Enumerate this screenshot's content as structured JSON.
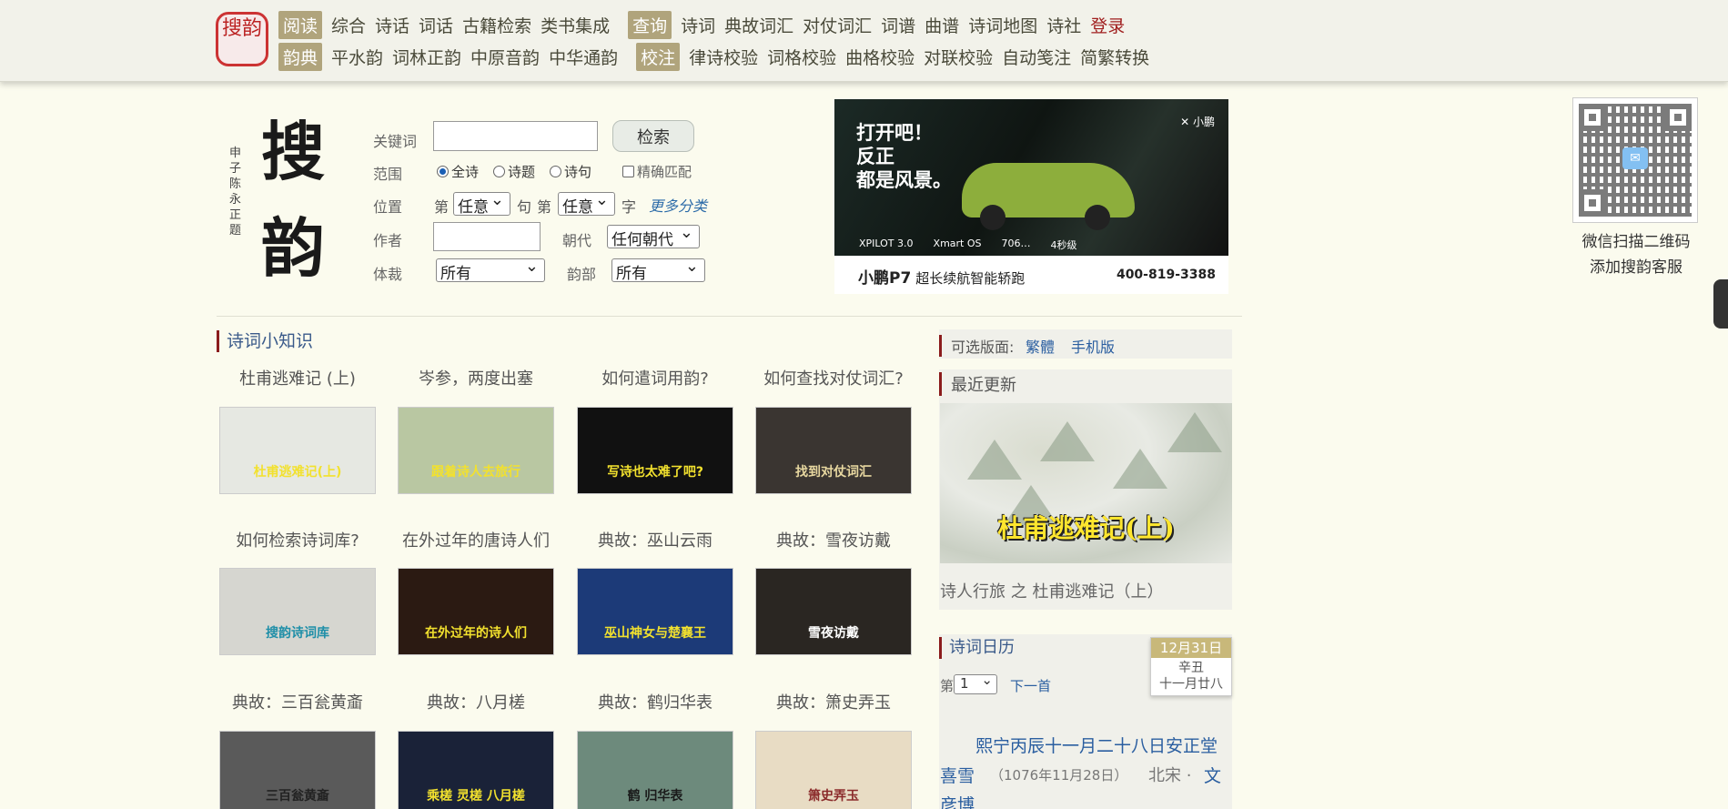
{
  "brand": {
    "logo_text": "搜韵"
  },
  "nav": {
    "row1": [
      {
        "label": "阅读",
        "tag": true
      },
      {
        "label": "综合"
      },
      {
        "label": "诗话"
      },
      {
        "label": "词话"
      },
      {
        "label": "古籍检索"
      },
      {
        "label": "类书集成"
      },
      {
        "label": "查询",
        "tag": true
      },
      {
        "label": "诗词"
      },
      {
        "label": "典故词汇"
      },
      {
        "label": "对仗词汇"
      },
      {
        "label": "词谱"
      },
      {
        "label": "曲谱"
      },
      {
        "label": "诗词地图"
      },
      {
        "label": "诗社"
      },
      {
        "label": "登录",
        "login": true
      }
    ],
    "row2": [
      {
        "label": "韵典",
        "tag": true
      },
      {
        "label": "平水韵"
      },
      {
        "label": "词林正韵"
      },
      {
        "label": "中原音韵"
      },
      {
        "label": "中华通韵"
      },
      {
        "label": "校注",
        "tag": true
      },
      {
        "label": "律诗校验"
      },
      {
        "label": "词格校验"
      },
      {
        "label": "曲格校验"
      },
      {
        "label": "对联校验"
      },
      {
        "label": "自动笺注"
      },
      {
        "label": "简繁转换"
      }
    ]
  },
  "search": {
    "calligraphy_big": "搜韵",
    "calligraphy_small": "申子陈永正题",
    "keyword_label": "关键词",
    "search_button": "检索",
    "scope_label": "范围",
    "scope_options": [
      "全诗",
      "诗题",
      "诗句"
    ],
    "scope_selected": "全诗",
    "exact_match": "精确匹配",
    "position_label": "位置",
    "pos_di1": "第",
    "pos_sentence_sel": "任意",
    "pos_ju": "句",
    "pos_di2": "第",
    "pos_char_sel": "任意",
    "pos_zi": "字",
    "more_categories": "更多分类",
    "author_label": "作者",
    "dynasty_label": "朝代",
    "dynasty_sel": "任何朝代",
    "genre_label": "体裁",
    "genre_sel": "所有",
    "rhyme_label": "韵部",
    "rhyme_sel": "所有"
  },
  "ad": {
    "headline": [
      "打开吧！",
      "反正",
      "都是风景。"
    ],
    "brand": "✕ 小鹏",
    "specs": [
      "XPILOT 3.0",
      "Xmart OS",
      "706…",
      "4秒级"
    ],
    "model": "小鹏P7",
    "tagline": "超长续航智能轿跑",
    "phone": "400-819-3388"
  },
  "qr": {
    "caption_line1": "微信扫描二维码",
    "caption_line2": "添加搜韵客服"
  },
  "knowledge": {
    "title": "诗词小知识",
    "items": [
      {
        "caption": "杜甫逃难记 (上)",
        "img_label": "杜甫逃难记(上)",
        "bg": "#e6e8e2",
        "fg": "#f2e12e"
      },
      {
        "caption": "岑参，两度出塞",
        "img_label": "跟着诗人去旅行",
        "bg": "#b9c7a2",
        "fg": "#f2e12e"
      },
      {
        "caption": "如何遣词用韵?",
        "img_label": "写诗也太难了吧?",
        "bg": "#111111",
        "fg": "#f2e12e"
      },
      {
        "caption": "如何查找对仗词汇?",
        "img_label": "找到对仗词汇",
        "bg": "#3a3531",
        "fg": "#e8d8a0"
      },
      {
        "caption": "如何检索诗词库?",
        "img_label": "搜韵诗词库",
        "bg": "#d6d6d0",
        "fg": "#1f8fa8"
      },
      {
        "caption": "在外过年的唐诗人们",
        "img_label": "在外过年的诗人们",
        "bg": "#2b1a12",
        "fg": "#f2e12e"
      },
      {
        "caption": "典故：巫山云雨",
        "img_label": "巫山神女与楚襄王",
        "bg": "#1c3a78",
        "fg": "#f2e12e"
      },
      {
        "caption": "典故：雪夜访戴",
        "img_label": "雪夜访戴",
        "bg": "#2a2622",
        "fg": "#ffffff"
      },
      {
        "caption": "典故：三百瓮黄齑",
        "img_label": "三百瓮黄齑",
        "bg": "#5a5a5a",
        "fg": "#222222"
      },
      {
        "caption": "典故：八月槎",
        "img_label": "乘槎 灵槎 八月槎",
        "bg": "#1a2238",
        "fg": "#f2e12e"
      },
      {
        "caption": "典故：鹤归华表",
        "img_label": "鹤 归华表",
        "bg": "#6d8a7c",
        "fg": "#1a1a1a"
      },
      {
        "caption": "典故：箫史弄玉",
        "img_label": "箫史弄玉",
        "bg": "#e8dcc4",
        "fg": "#8a2a2a"
      }
    ]
  },
  "right": {
    "version_label": "可选版面:",
    "version_links": [
      "繁體",
      "手机版"
    ],
    "recent_title": "最近更新",
    "recent_img_label": "杜甫逃难记(上)",
    "recent_caption": "诗人行旅 之 杜甫逃难记（上）",
    "calendar_title": "诗词日历",
    "date_top": "12月31日",
    "date_line1": "辛丑",
    "date_line2": "十一月廿八",
    "page_prefix": "第",
    "page_value": "1",
    "next_link": "下一首",
    "poem_line1": "熙宁丙辰十一月二十八日安正堂",
    "poem_title_end": "喜雪",
    "poem_date": "（1076年11月28日）",
    "poem_dynasty": "北宋 ·",
    "poem_author_part1": "文",
    "poem_author_part2": "彦博"
  }
}
